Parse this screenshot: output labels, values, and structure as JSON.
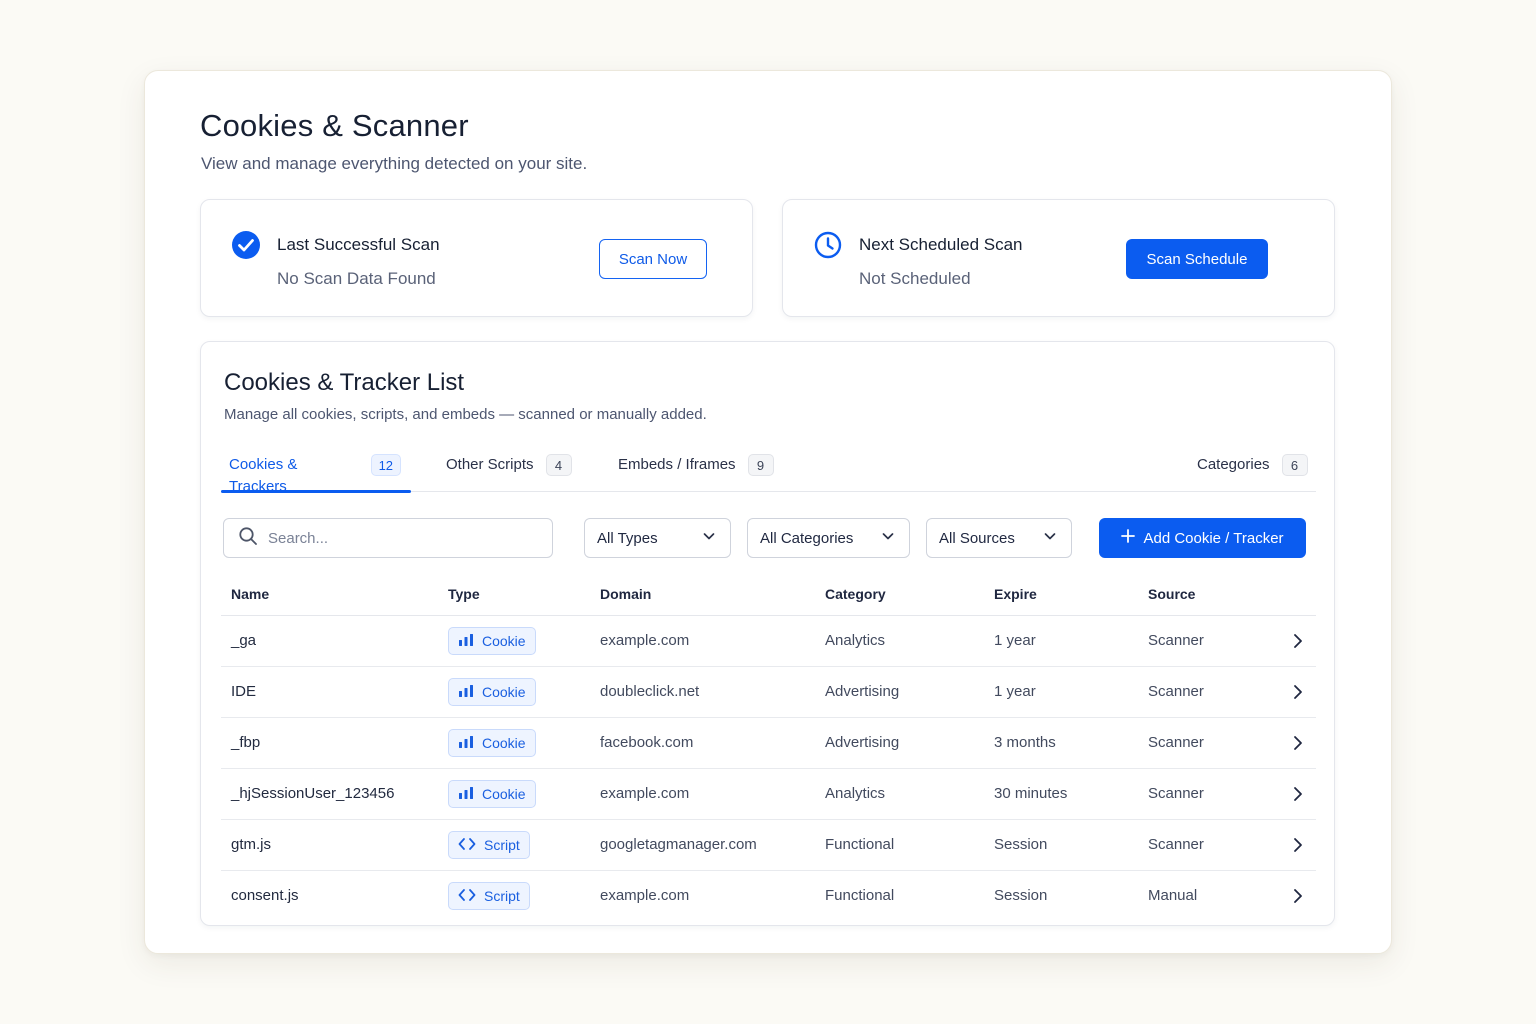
{
  "page": {
    "title": "Cookies & Scanner",
    "subtitle": "View and manage everything detected on your site."
  },
  "last_scan": {
    "label": "Last Successful Scan",
    "value": "No Scan Data Found",
    "button": "Scan Now",
    "icon": "check-circle-icon"
  },
  "next_scan": {
    "label": "Next Scheduled Scan",
    "value": "Not Scheduled",
    "button": "Scan Schedule",
    "icon": "clock-icon"
  },
  "list": {
    "title": "Cookies & Tracker List",
    "subtitle": "Manage all cookies, scripts, and embeds — scanned or manually added.",
    "tabs": [
      {
        "label": "Cookies & Trackers",
        "count": "12",
        "active": true
      },
      {
        "label": "Other Scripts",
        "count": "4",
        "active": false
      },
      {
        "label": "Embeds / Iframes",
        "count": "9",
        "active": false
      },
      {
        "label": "Categories",
        "count": "6",
        "active": false
      }
    ],
    "search": {
      "placeholder": "Search...",
      "value": ""
    },
    "filters": {
      "types": "All Types",
      "categories": "All Categories",
      "sources": "All Sources"
    },
    "add_button": "Add Cookie / Tracker",
    "columns": [
      "Name",
      "Type",
      "Domain",
      "Category",
      "Expire",
      "Source"
    ],
    "rows": [
      {
        "name": "_ga",
        "type": "Cookie",
        "type_icon": "bar-chart-icon",
        "domain": "example.com",
        "category": "Analytics",
        "expire": "1 year",
        "source": "Scanner"
      },
      {
        "name": "IDE",
        "type": "Cookie",
        "type_icon": "bar-chart-icon",
        "domain": "doubleclick.net",
        "category": "Advertising",
        "expire": "1 year",
        "source": "Scanner"
      },
      {
        "name": "_fbp",
        "type": "Cookie",
        "type_icon": "bar-chart-icon",
        "domain": "facebook.com",
        "category": "Advertising",
        "expire": "3 months",
        "source": "Scanner"
      },
      {
        "name": "_hjSessionUser_123456",
        "type": "Cookie",
        "type_icon": "bar-chart-icon",
        "domain": "example.com",
        "category": "Analytics",
        "expire": "30 minutes",
        "source": "Scanner"
      },
      {
        "name": "gtm.js",
        "type": "Script",
        "type_icon": "code-icon",
        "domain": "googletagmanager.com",
        "category": "Functional",
        "expire": "Session",
        "source": "Scanner"
      },
      {
        "name": "consent.js",
        "type": "Script",
        "type_icon": "code-icon",
        "domain": "example.com",
        "category": "Functional",
        "expire": "Session",
        "source": "Manual"
      }
    ]
  },
  "colors": {
    "accent": "#0b5cf0",
    "background": "#fbfaf5",
    "badge_bg": "#eef4ff"
  }
}
